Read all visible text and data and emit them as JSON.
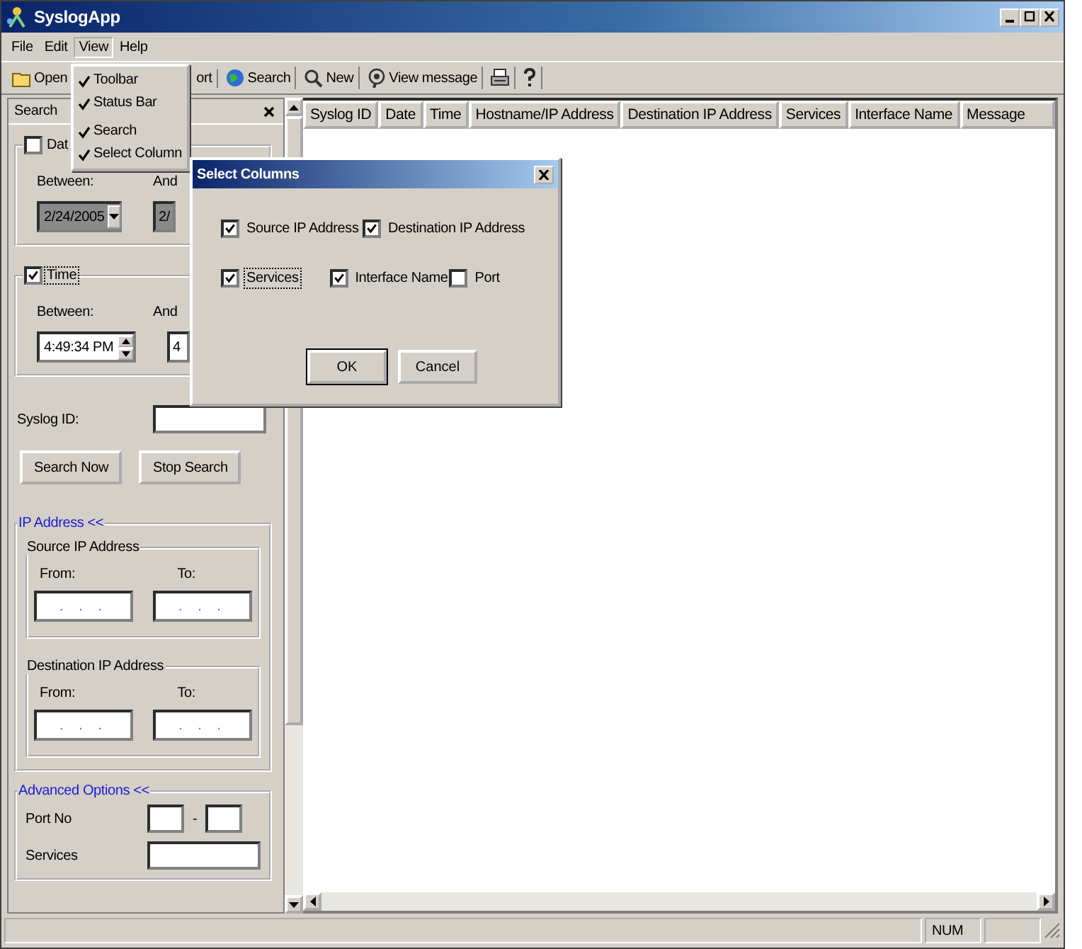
{
  "window": {
    "title": "SyslogApp"
  },
  "menu_bar": [
    {
      "label": "File",
      "selected": false
    },
    {
      "label": "Edit",
      "selected": false
    },
    {
      "label": "View",
      "selected": true
    },
    {
      "label": "Help",
      "selected": false
    }
  ],
  "view_menu": [
    {
      "label": "Toolbar",
      "checked": true
    },
    {
      "label": "Status Bar",
      "checked": true
    },
    {
      "label": "Search",
      "checked": true
    },
    {
      "label": "Select Column",
      "checked": true
    }
  ],
  "toolbar": [
    {
      "label": "Open"
    },
    {
      "label": "ort"
    },
    {
      "label": "Search"
    },
    {
      "label": "New"
    },
    {
      "label": "View message"
    }
  ],
  "search_panel": {
    "title": "Search",
    "date_filter": {
      "label": "Dat",
      "checked": false,
      "between_label": "Between:",
      "from_date": "2/24/2005",
      "and_label": "And",
      "to_date": "2/"
    },
    "time_filter": {
      "label": "Time",
      "checked": true,
      "between_label": "Between:",
      "from_time": "4:49:34 PM",
      "and_label": "And",
      "to_time": "4"
    },
    "syslog_id": {
      "label": "Syslog ID:"
    },
    "buttons": [
      "Search Now",
      "Stop Search"
    ],
    "ip_address": {
      "title": "IP Address <<",
      "groups": [
        {
          "title": "Source IP Address",
          "from_label": "From:",
          "from_value": ". . .",
          "to_label": "To:",
          "to_value": ". . ."
        },
        {
          "title": "Destination IP Address",
          "from_label": "From:",
          "from_value": ". . .",
          "to_label": "To:",
          "to_value": ". . ."
        }
      ]
    },
    "advanced_options": {
      "title": "Advanced Options <<",
      "port_label": "Port No",
      "port_separator": "-",
      "services_label": "Services"
    }
  },
  "table": {
    "columns": [
      "Syslog ID",
      "Date",
      "Time",
      "Hostname/IP Address",
      "Destination IP Address",
      "Services",
      "Interface Name",
      "Message"
    ]
  },
  "dialog": {
    "title": "Select Columns",
    "rows": [
      [
        {
          "label": "Source IP Address",
          "checked": true,
          "focused": false
        },
        {
          "label": "Destination IP Address",
          "checked": true,
          "focused": false
        }
      ],
      [
        {
          "label": "Services",
          "checked": true,
          "focused": true
        },
        {
          "label": "Interface Name",
          "checked": true,
          "focused": false
        },
        {
          "label": "Port",
          "checked": false,
          "focused": false
        }
      ]
    ],
    "buttons": [
      {
        "label": "OK",
        "default": true
      },
      {
        "label": "Cancel",
        "default": false
      }
    ]
  },
  "status_bar": {
    "indicator": "NUM"
  }
}
